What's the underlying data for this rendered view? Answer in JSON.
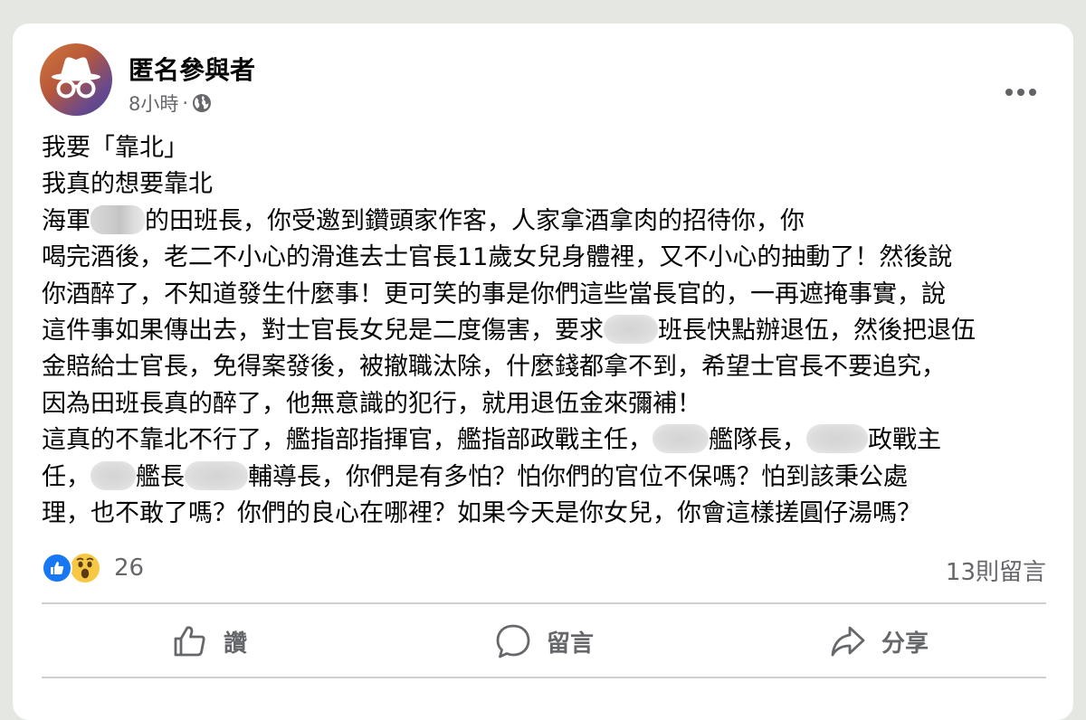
{
  "post": {
    "author": "匿名參與者",
    "time": "8小時",
    "separator": "·",
    "privacy_icon": "globe-icon",
    "lines": [
      {
        "segments": [
          {
            "text": "我要「靠北」"
          }
        ]
      },
      {
        "segments": [
          {
            "text": "我真的想要靠北"
          }
        ]
      },
      {
        "segments": [
          {
            "text": "海軍"
          },
          {
            "blur": true
          },
          {
            "text": "的田班長，你受邀到鑽頭家作客，人家拿酒拿肉的招待你，你"
          }
        ]
      },
      {
        "segments": [
          {
            "text": "喝完酒後，老二不小心的滑進去士官長11歲女兒身體裡，又不小心的抽動了！然後說"
          }
        ]
      },
      {
        "segments": [
          {
            "text": "你酒醉了，不知道發生什麼事！更可笑的事是你們這些當長官的，一再遮掩事實，說"
          }
        ]
      },
      {
        "segments": [
          {
            "text": "這件事如果傳出去，對士官長女兒是二度傷害，要求"
          },
          {
            "blur": true
          },
          {
            "text": "班長快點辦退伍，然後把退伍"
          }
        ]
      },
      {
        "segments": [
          {
            "text": "金賠給士官長，免得案發後，被撤職汰除，什麼錢都拿不到，希望士官長不要追究，"
          }
        ]
      },
      {
        "segments": [
          {
            "text": "因為田班長真的醉了，他無意識的犯行，就用退伍金來彌補！"
          }
        ]
      },
      {
        "segments": [
          {
            "text": "這真的不靠北不行了，艦指部指揮官，艦指部政戰主任，"
          },
          {
            "blur": true
          },
          {
            "text": "艦隊長，"
          },
          {
            "blur": true
          },
          {
            "text": "政戰主"
          }
        ]
      },
      {
        "segments": [
          {
            "text": "任，"
          },
          {
            "blur": true
          },
          {
            "text": "艦長"
          },
          {
            "blur": true
          },
          {
            "text": "輔導長，你們是有多怕？怕你們的官位不保嗎？怕到該秉公處"
          }
        ]
      },
      {
        "segments": [
          {
            "text": "理，也不敢了嗎？你們的良心在哪裡？如果今天是你女兒，你會這樣搓圓仔湯嗎？"
          }
        ]
      }
    ]
  },
  "reactions": {
    "icons": [
      "like-reaction-icon",
      "wow-reaction-icon"
    ],
    "count": "26"
  },
  "comments": {
    "count_label": "13則留言"
  },
  "actions": {
    "like": {
      "label": "讚",
      "icon": "thumbs-up-icon"
    },
    "comment": {
      "label": "留言",
      "icon": "speech-bubble-icon"
    },
    "share": {
      "label": "分享",
      "icon": "share-arrow-icon"
    }
  },
  "colors": {
    "background": "#e4e7e2",
    "card": "#ffffff",
    "text": "#050505",
    "secondary_text": "#65676b",
    "like_blue": "#1877f2",
    "wow_yellow": "#f7c844",
    "divider": "#ced0d4"
  }
}
